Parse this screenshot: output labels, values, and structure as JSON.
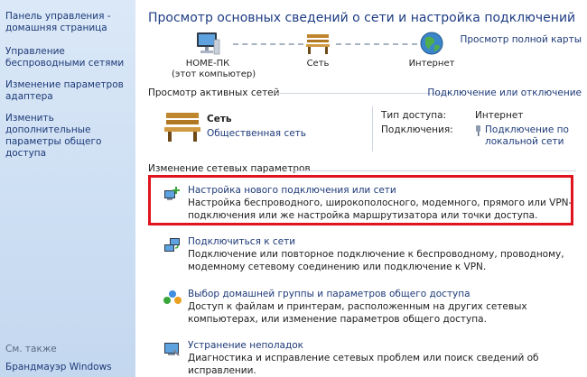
{
  "sidebar": {
    "home": "Панель управления - домашняя страница",
    "items": [
      {
        "label": "Управление беспроводными сетями"
      },
      {
        "label": "Изменение параметров адаптера"
      },
      {
        "label": "Изменить дополнительные параметры общего доступа"
      }
    ],
    "see_also_title": "См. также",
    "see_also_link": "Брандмауэр Windows"
  },
  "main": {
    "title": "Просмотр основных сведений о сети и настройка подключений",
    "full_map_link": "Просмотр полной карты",
    "map": {
      "computer_name": "HOME-ПК",
      "computer_sub": "(этот компьютер)",
      "network": "Сеть",
      "internet": "Интернет"
    },
    "active": {
      "header": "Просмотр активных сетей",
      "connect_link": "Подключение или отключение",
      "network_name": "Сеть",
      "network_type": "Общественная сеть",
      "access_label": "Тип доступа:",
      "access_value": "Интернет",
      "connections_label": "Подключения:",
      "connections_value": "Подключение по локальной сети"
    },
    "change_header": "Изменение сетевых параметров",
    "tasks": [
      {
        "link": "Настройка нового подключения или сети",
        "desc": "Настройка беспроводного, широкополосного, модемного, прямого или VPN-подключения или же настройка маршрутизатора или точки доступа."
      },
      {
        "link": "Подключиться к сети",
        "desc": "Подключение или повторное подключение к беспроводному, проводному, модемному сетевому соединению или подключение к VPN."
      },
      {
        "link": "Выбор домашней группы и параметров общего доступа",
        "desc": "Доступ к файлам и принтерам, расположенным на других сетевых компьютерах, или изменение параметров общего доступа."
      },
      {
        "link": "Устранение неполадок",
        "desc": "Диагностика и исправление сетевых проблем или поиск сведений об исправлении."
      }
    ]
  },
  "colors": {
    "link": "#1d3a78",
    "title": "#1e3d84",
    "highlight": "#e0141e",
    "sidebar": "#cddff3"
  }
}
